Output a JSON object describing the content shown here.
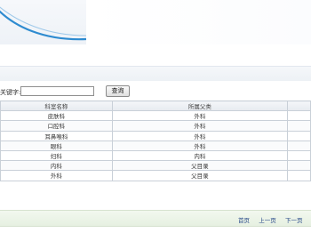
{
  "search": {
    "label": "关键字:",
    "value": "",
    "button_label": "查询"
  },
  "table": {
    "headers": [
      "科室名称",
      "所属父类",
      ""
    ],
    "rows": [
      [
        "皮肤科",
        "外科"
      ],
      [
        "口腔科",
        "外科"
      ],
      [
        "耳鼻喉科",
        "外科"
      ],
      [
        "眼科",
        "外科"
      ],
      [
        "妇科",
        "内科"
      ],
      [
        "内科",
        "父目录"
      ],
      [
        "外科",
        "父目录"
      ]
    ]
  },
  "pager": {
    "first": "首页",
    "prev": "上一页",
    "next": "下一页",
    "last": "尾"
  },
  "colors": {
    "swoosh": "#2e8bd0",
    "link": "#2a4b8a",
    "footer_bg": "#e6f0e1"
  }
}
